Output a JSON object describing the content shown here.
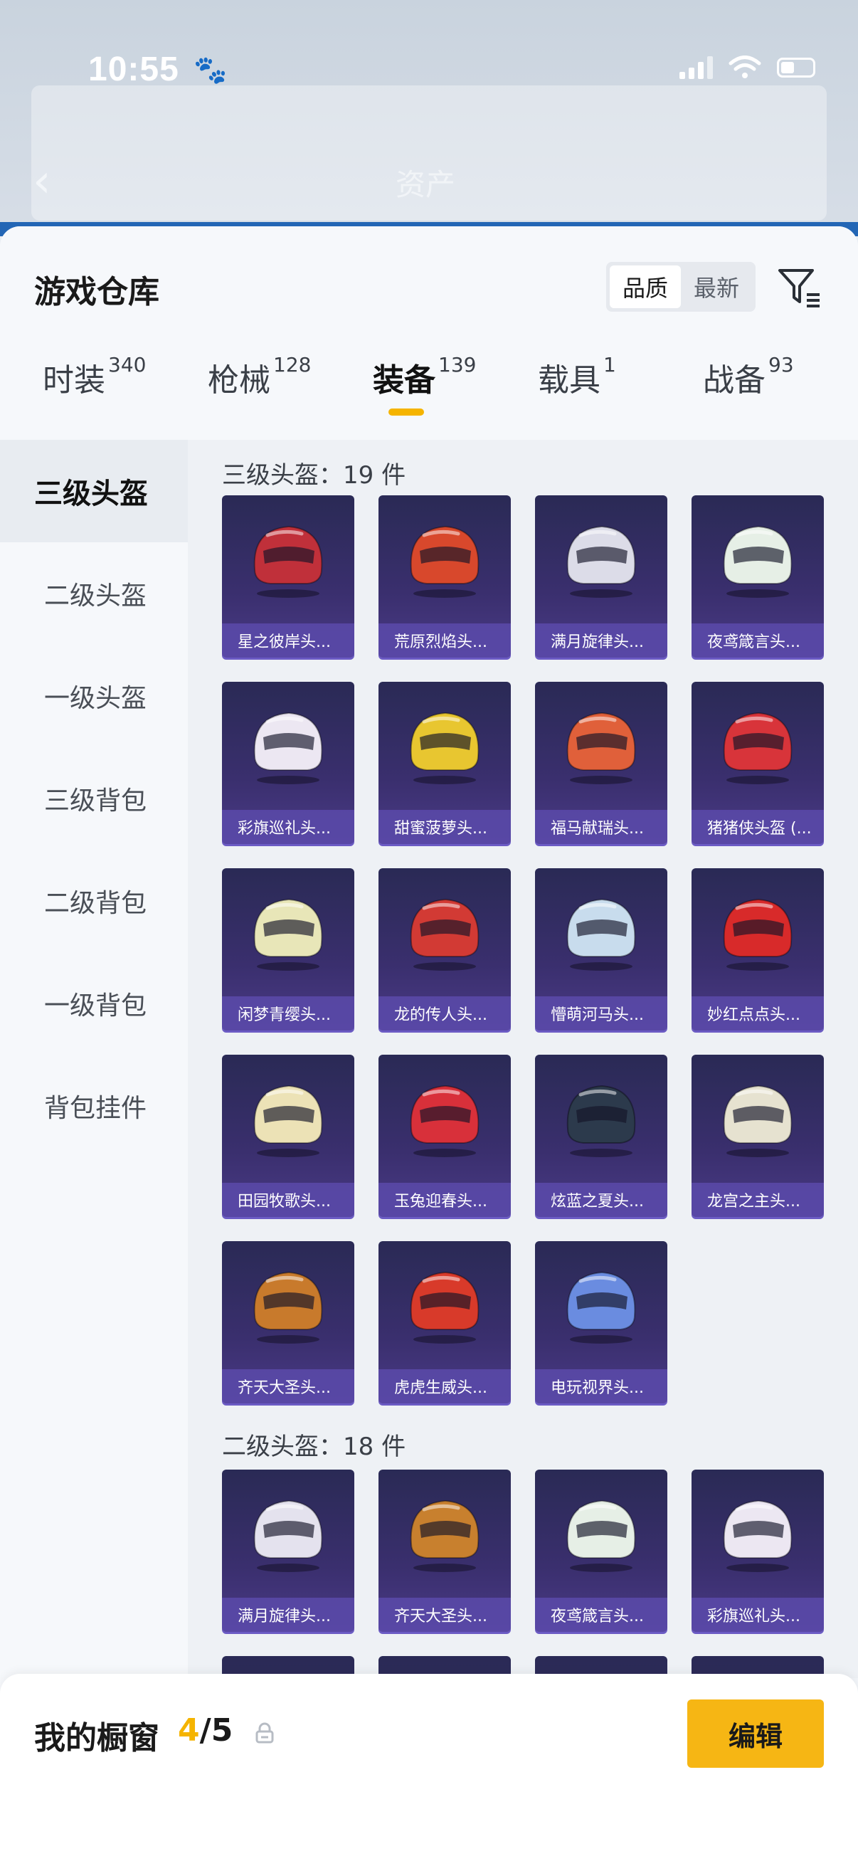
{
  "status_bar": {
    "time": "10:55"
  },
  "background": {
    "title": "资产"
  },
  "sheet": {
    "title": "游戏仓库",
    "sort_options": [
      "品质",
      "最新"
    ],
    "active_sort": "品质"
  },
  "tabs": [
    {
      "label": "时装",
      "count": "340"
    },
    {
      "label": "枪械",
      "count": "128"
    },
    {
      "label": "装备",
      "count": "139"
    },
    {
      "label": "载具",
      "count": "1"
    },
    {
      "label": "战备",
      "count": "93"
    }
  ],
  "active_tab": "装备",
  "sidebar": {
    "items": [
      "三级头盔",
      "二级头盔",
      "一级头盔",
      "三级背包",
      "二级背包",
      "一级背包",
      "背包挂件"
    ],
    "active": "三级头盔"
  },
  "sections": [
    {
      "title": "三级头盔：19 件",
      "items": [
        {
          "name": "星之彼岸头...",
          "color": "#c0303a"
        },
        {
          "name": "荒原烈焰头...",
          "color": "#d8482c"
        },
        {
          "name": "满月旋律头...",
          "color": "#dcdce8"
        },
        {
          "name": "夜鸢箴言头...",
          "color": "#e6efe6"
        },
        {
          "name": "彩旗巡礼头...",
          "color": "#ece7f2"
        },
        {
          "name": "甜蜜菠萝头...",
          "color": "#e8c630"
        },
        {
          "name": "福马献瑞头...",
          "color": "#e0603a"
        },
        {
          "name": "猪猪侠头盔 (...",
          "color": "#d8343a"
        },
        {
          "name": "闲梦青缨头...",
          "color": "#e8e6b8"
        },
        {
          "name": "龙的传人头...",
          "color": "#d23a34"
        },
        {
          "name": "懵萌河马头...",
          "color": "#c8dced"
        },
        {
          "name": "妙红点点头...",
          "color": "#d82a2a"
        },
        {
          "name": "田园牧歌头...",
          "color": "#ece2b6"
        },
        {
          "name": "玉兔迎春头...",
          "color": "#d8303a"
        },
        {
          "name": "炫蓝之夏头...",
          "color": "#2c3a4c"
        },
        {
          "name": "龙宫之主头...",
          "color": "#e6e2d0"
        },
        {
          "name": "齐天大圣头...",
          "color": "#c87a2c"
        },
        {
          "name": "虎虎生威头...",
          "color": "#d83a2a"
        },
        {
          "name": "电玩视界头...",
          "color": "#6a8ce0"
        }
      ]
    },
    {
      "title": "二级头盔：18 件",
      "items": [
        {
          "name": "满月旋律头...",
          "color": "#e4e2ee"
        },
        {
          "name": "齐天大圣头...",
          "color": "#c8802e"
        },
        {
          "name": "夜鸢箴言头...",
          "color": "#e6efe6"
        },
        {
          "name": "彩旗巡礼头...",
          "color": "#ece7f2"
        }
      ]
    }
  ],
  "bottom_bar": {
    "label": "我的橱窗",
    "current": "4",
    "total": "5",
    "edit_label": "编辑"
  },
  "colors": {
    "accent": "#f6b614",
    "card_bg": "#2f2c62",
    "card_label_bg": "#5a4aaa"
  }
}
